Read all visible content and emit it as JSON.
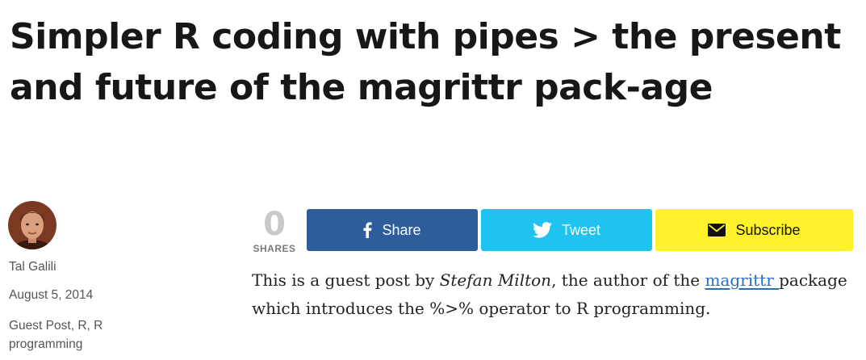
{
  "post": {
    "title": "Simpler R coding with pipes > the present and future of the magrittr pack-age"
  },
  "author": {
    "name": "Tal Galili",
    "date": "August 5, 2014",
    "categories": [
      "Guest Post",
      "R",
      "R programming"
    ]
  },
  "share_bar": {
    "count": "0",
    "count_label": "SHARES",
    "buttons": [
      {
        "label": "Share",
        "icon": "facebook-icon",
        "color": "#2d5e9b"
      },
      {
        "label": "Tweet",
        "icon": "twitter-icon",
        "color": "#1fc3ef"
      },
      {
        "label": "Subscribe",
        "icon": "envelope-icon",
        "color": "#fff22a"
      }
    ]
  },
  "intro": {
    "text_1": "This is a guest post by ",
    "guest_name": "Stefan Milton",
    "text_2": ", the author of the ",
    "link_text": "magrittr ",
    "text_3": "package which introduces the %>% operator to R programming."
  }
}
